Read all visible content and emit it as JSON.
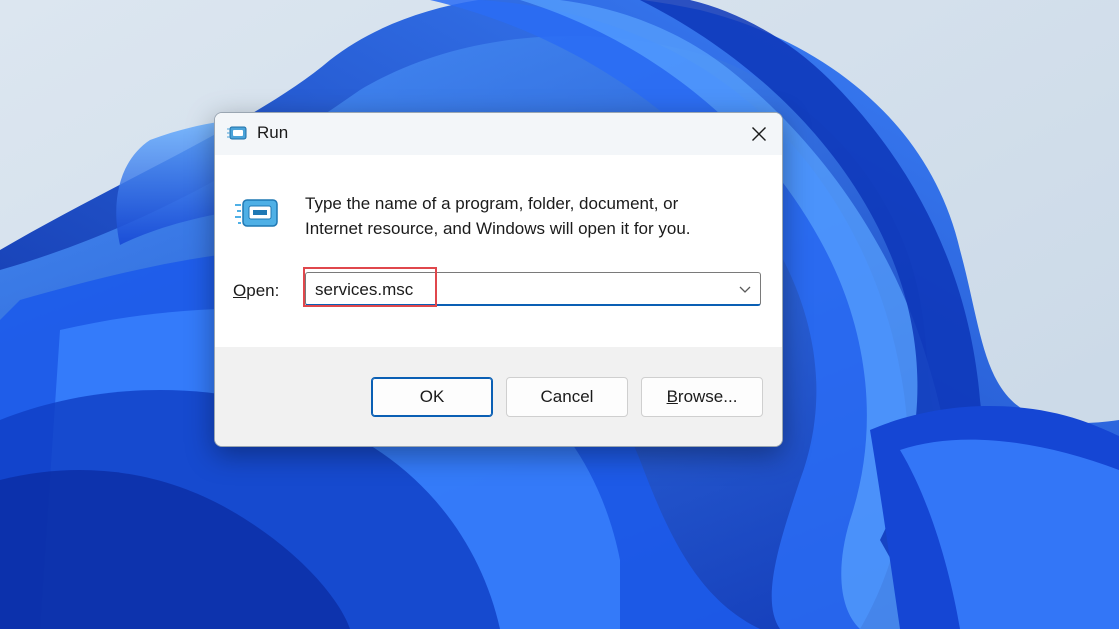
{
  "dialog": {
    "title": "Run",
    "description_line1": "Type the name of a program, folder, document, or",
    "description_line2": "Internet resource, and Windows will open it for you.",
    "open_label_access_key": "O",
    "open_label_rest": "pen:",
    "open_value": "services.msc",
    "ok_label": "OK",
    "cancel_label": "Cancel",
    "browse_access_key": "B",
    "browse_rest": "rowse...",
    "close_icon": "close-icon",
    "dropdown_icon": "chevron-down-icon",
    "run_icon": "run-icon"
  },
  "colors": {
    "accent": "#0a5fb4",
    "highlight_box": "#e0474c",
    "wallpaper_blue": "#1a4fd6"
  }
}
